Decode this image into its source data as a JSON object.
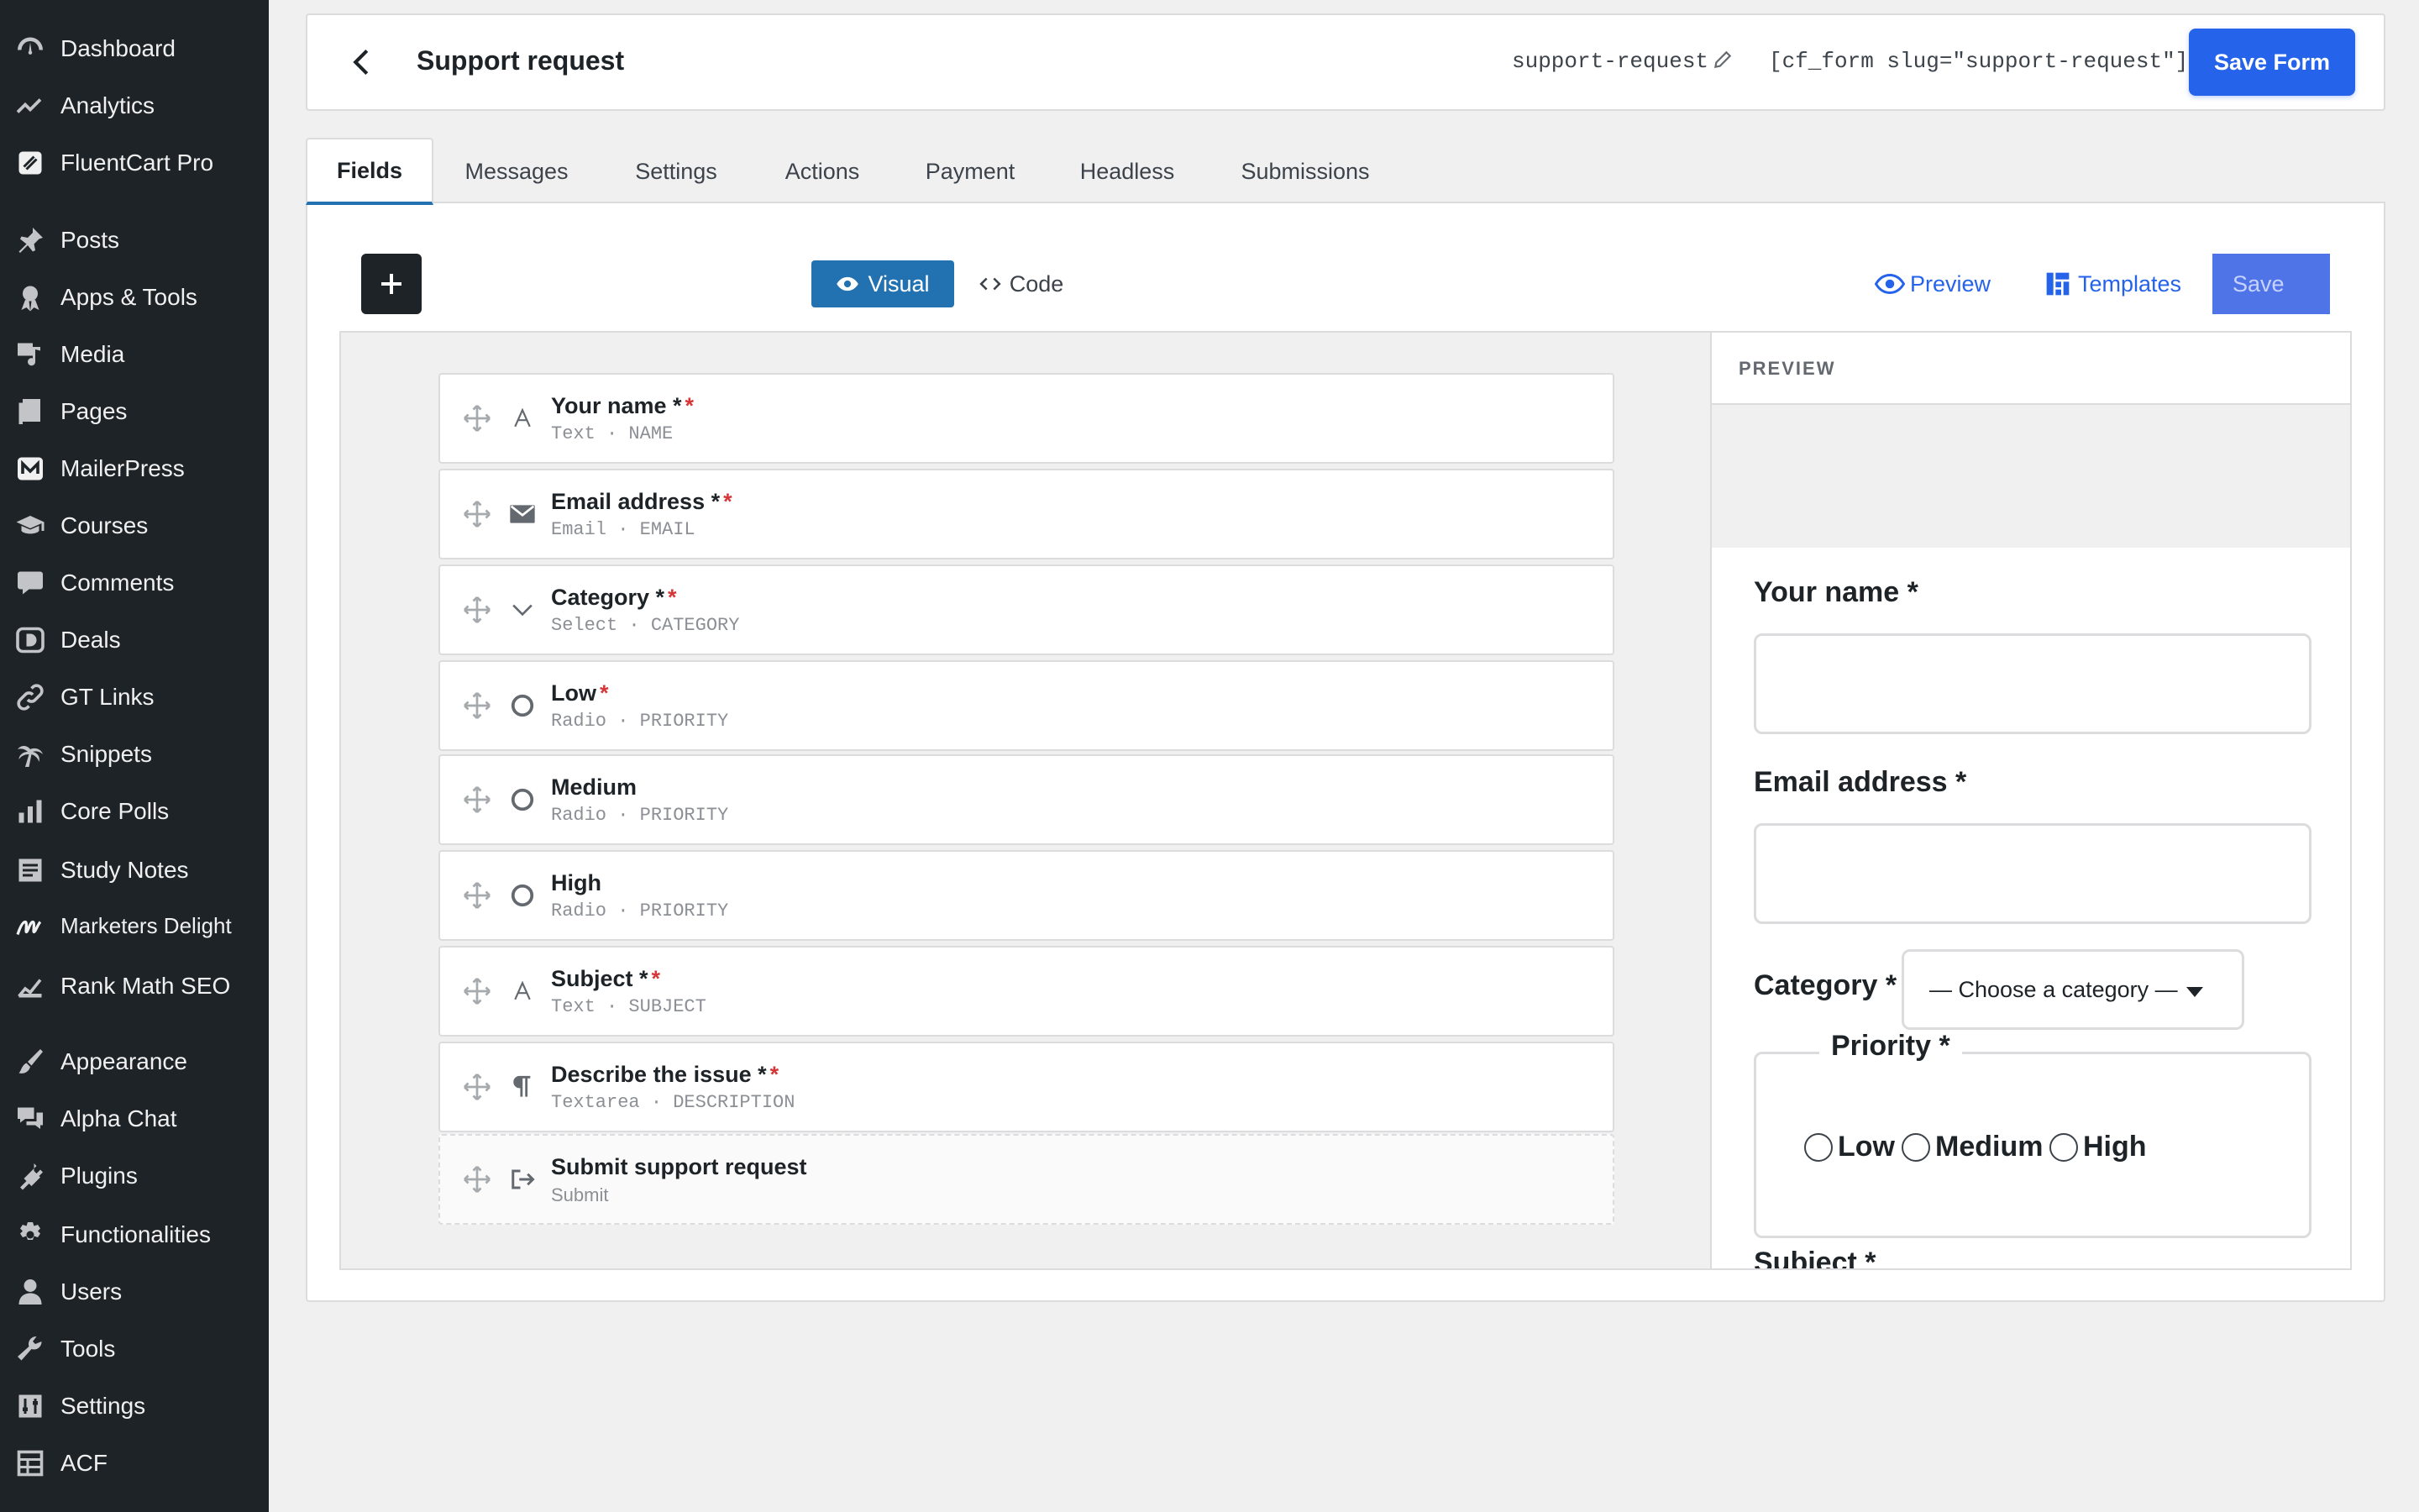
{
  "sidebar": {
    "items": [
      {
        "label": "Dashboard",
        "icon": "dashboard-icon"
      },
      {
        "label": "Analytics",
        "icon": "analytics-icon"
      },
      {
        "label": "FluentCart Pro",
        "icon": "fluentcart-icon"
      },
      {
        "label": "Posts",
        "icon": "pin-icon"
      },
      {
        "label": "Apps & Tools",
        "icon": "award-icon"
      },
      {
        "label": "Media",
        "icon": "media-icon"
      },
      {
        "label": "Pages",
        "icon": "pages-icon"
      },
      {
        "label": "MailerPress",
        "icon": "mailerpress-icon"
      },
      {
        "label": "Courses",
        "icon": "graduation-cap-icon"
      },
      {
        "label": "Comments",
        "icon": "comment-icon"
      },
      {
        "label": "Deals",
        "icon": "deals-icon"
      },
      {
        "label": "GT Links",
        "icon": "link-icon"
      },
      {
        "label": "Snippets",
        "icon": "palm-tree-icon"
      },
      {
        "label": "Core Polls",
        "icon": "bar-chart-icon"
      },
      {
        "label": "Study Notes",
        "icon": "notes-icon"
      },
      {
        "label": "Marketers Delight",
        "icon": "marketers-delight-icon"
      },
      {
        "label": "Rank Math SEO",
        "icon": "rank-math-icon"
      },
      {
        "label": "Appearance",
        "icon": "paintbrush-icon"
      },
      {
        "label": "Alpha Chat",
        "icon": "chat-icon"
      },
      {
        "label": "Plugins",
        "icon": "plug-icon"
      },
      {
        "label": "Functionalities",
        "icon": "gear-icon"
      },
      {
        "label": "Users",
        "icon": "user-icon"
      },
      {
        "label": "Tools",
        "icon": "wrench-icon"
      },
      {
        "label": "Settings",
        "icon": "settings-sliders-icon"
      },
      {
        "label": "ACF",
        "icon": "acf-table-icon"
      }
    ]
  },
  "header": {
    "title": "Support request",
    "slug": "support-request",
    "shortcode": "[cf_form slug=\"support-request\"]",
    "save_form_label": "Save Form"
  },
  "tabs": [
    "Fields",
    "Messages",
    "Settings",
    "Actions",
    "Payment",
    "Headless",
    "Submissions"
  ],
  "toolbar": {
    "visual_label": "Visual",
    "code_label": "Code",
    "preview_label": "Preview",
    "templates_label": "Templates",
    "save_label": "Save"
  },
  "fields": [
    {
      "label": "Your name *",
      "required": "*",
      "meta": "Text · NAME",
      "icon": "text-icon"
    },
    {
      "label": "Email address *",
      "required": "*",
      "meta": "Email · EMAIL",
      "icon": "email-icon"
    },
    {
      "label": "Category *",
      "required": "*",
      "meta": "Select · CATEGORY",
      "icon": "chevron-down-icon"
    },
    {
      "label": "Low",
      "required": "*",
      "meta": "Radio · PRIORITY",
      "icon": "radio-icon"
    },
    {
      "label": "Medium",
      "required": "",
      "meta": "Radio · PRIORITY",
      "icon": "radio-icon"
    },
    {
      "label": "High",
      "required": "",
      "meta": "Radio · PRIORITY",
      "icon": "radio-icon"
    },
    {
      "label": "Subject *",
      "required": "*",
      "meta": "Text · SUBJECT",
      "icon": "text-icon"
    },
    {
      "label": "Describe the issue *",
      "required": "*",
      "meta": "Textarea · DESCRIPTION",
      "icon": "paragraph-icon"
    },
    {
      "label": "Submit support request",
      "required": "",
      "meta": "Submit",
      "icon": "submit-icon"
    }
  ],
  "preview": {
    "heading": "PREVIEW",
    "name_label": "Your name *",
    "email_label": "Email address *",
    "category_label": "Category *",
    "category_placeholder": "— Choose a category —",
    "priority_legend": "Priority *",
    "priority_options": [
      "Low",
      "Medium",
      "High"
    ],
    "subject_label": "Subject *"
  },
  "colors": {
    "sidebar_bg": "#1d2327",
    "accent_blue": "#2563eb",
    "wp_blue": "#2271b1",
    "required_red": "#d63638"
  }
}
